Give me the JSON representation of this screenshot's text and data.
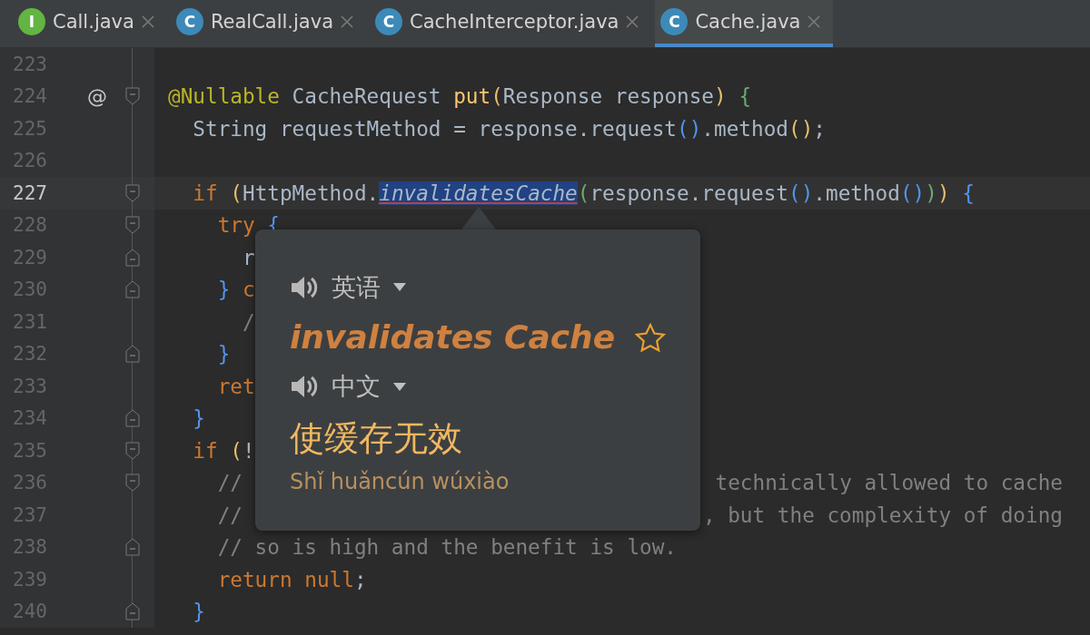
{
  "tabs": [
    {
      "icon_letter": "I",
      "color": "#62b543",
      "label": "Call.java",
      "selected": false
    },
    {
      "icon_letter": "C",
      "color": "#3d8ab8",
      "label": "RealCall.java",
      "selected": false
    },
    {
      "icon_letter": "C",
      "color": "#3d8ab8",
      "label": "CacheInterceptor.java",
      "selected": false
    },
    {
      "icon_letter": "C",
      "color": "#3d8ab8",
      "label": "Cache.java",
      "selected": true
    }
  ],
  "lines": [
    {
      "number": "223",
      "current": false,
      "kind": "plain"
    },
    {
      "number": "224",
      "current": false,
      "marker": "@",
      "kind": "fold-start",
      "tokens": [
        {
          "kind": "annotation",
          "text": "@Nullable"
        },
        {
          "kind": "plain",
          "text": " CacheRequest "
        },
        {
          "kind": "method",
          "text": "put"
        },
        {
          "kind": "bracket-1",
          "text": "("
        },
        {
          "kind": "plain",
          "text": "Response response"
        },
        {
          "kind": "bracket-1",
          "text": ")"
        },
        {
          "kind": "bracket-2",
          "text": " {"
        }
      ]
    },
    {
      "number": "225",
      "current": false,
      "kind": "plain",
      "tokens": [
        {
          "kind": "plain",
          "text": "  String requestMethod = response.request"
        },
        {
          "kind": "bracket-3",
          "text": "()"
        },
        {
          "kind": "plain",
          "text": ".method"
        },
        {
          "kind": "bracket-1",
          "text": "()"
        },
        {
          "kind": "plain",
          "text": ";"
        }
      ]
    },
    {
      "number": "226",
      "current": false,
      "kind": "plain"
    },
    {
      "number": "227",
      "current": true,
      "kind": "fold-start",
      "tokens": [
        {
          "kind": "keyword",
          "text": "  if "
        },
        {
          "kind": "bracket-1",
          "text": "("
        },
        {
          "kind": "plain",
          "text": "HttpMethod."
        },
        {
          "kind": "selected-static",
          "text": "invalidatesCache"
        },
        {
          "kind": "bracket-2",
          "text": "("
        },
        {
          "kind": "plain",
          "text": "response.request"
        },
        {
          "kind": "bracket-3",
          "text": "()"
        },
        {
          "kind": "plain",
          "text": ".method"
        },
        {
          "kind": "bracket-3",
          "text": "()"
        },
        {
          "kind": "bracket-2",
          "text": ")"
        },
        {
          "kind": "bracket-1",
          "text": ")"
        },
        {
          "kind": "bracket-3",
          "text": " {"
        }
      ]
    },
    {
      "number": "228",
      "current": false,
      "kind": "fold-start",
      "tokens": [
        {
          "kind": "keyword",
          "text": "    try "
        },
        {
          "kind": "bracket-3",
          "text": "{"
        }
      ]
    },
    {
      "number": "229",
      "current": false,
      "kind": "fold-end",
      "tokens": [
        {
          "kind": "plain",
          "text": "      r"
        }
      ]
    },
    {
      "number": "230",
      "current": false,
      "kind": "fold-end",
      "tokens": [
        {
          "kind": "bracket-3",
          "text": "    }"
        },
        {
          "kind": "keyword",
          "text": " c"
        }
      ]
    },
    {
      "number": "231",
      "current": false,
      "kind": "plain",
      "tokens": [
        {
          "kind": "comment",
          "text": "      /"
        }
      ]
    },
    {
      "number": "232",
      "current": false,
      "kind": "fold-end",
      "tokens": [
        {
          "kind": "bracket-3",
          "text": "    }"
        }
      ]
    },
    {
      "number": "233",
      "current": false,
      "kind": "plain",
      "tokens": [
        {
          "kind": "keyword",
          "text": "    ret"
        }
      ]
    },
    {
      "number": "234",
      "current": false,
      "kind": "fold-end",
      "tokens": [
        {
          "kind": "bracket-3",
          "text": "  }"
        }
      ]
    },
    {
      "number": "235",
      "current": false,
      "kind": "fold-start",
      "tokens": [
        {
          "kind": "keyword",
          "text": "  if "
        },
        {
          "kind": "bracket-1",
          "text": "("
        },
        {
          "kind": "plain",
          "text": "!"
        }
      ]
    },
    {
      "number": "236",
      "current": false,
      "kind": "fold-start",
      "tokens": [
        {
          "kind": "comment",
          "text": "    //"
        }
      ],
      "right": "technically allowed to cache"
    },
    {
      "number": "237",
      "current": false,
      "kind": "plain",
      "tokens": [
        {
          "kind": "comment",
          "text": "    //"
        }
      ],
      "right": ", but the complexity of doing"
    },
    {
      "number": "238",
      "current": false,
      "kind": "fold-end",
      "tokens": [
        {
          "kind": "comment",
          "text": "    // so is high and the benefit is low."
        }
      ]
    },
    {
      "number": "239",
      "current": false,
      "kind": "plain",
      "tokens": [
        {
          "kind": "keyword",
          "text": "    return null"
        },
        {
          "kind": "plain",
          "text": ";"
        }
      ]
    },
    {
      "number": "240",
      "current": false,
      "kind": "fold-end",
      "tokens": [
        {
          "kind": "bracket-3",
          "text": "  }"
        }
      ]
    }
  ],
  "translation_popup": {
    "source_language": "英语",
    "word": "invalidates Cache",
    "starred": false,
    "target_language": "中文",
    "translation": "使缓存无效",
    "pinyin": "Shǐ huǎncún wúxiào"
  }
}
